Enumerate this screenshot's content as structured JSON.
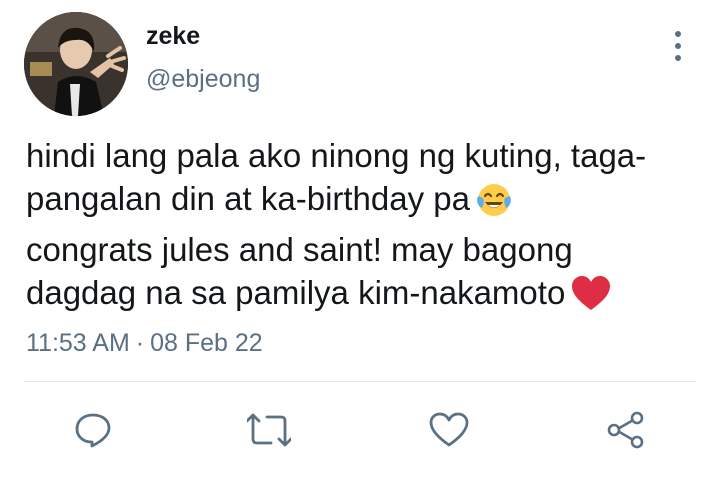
{
  "tweet": {
    "author": {
      "display_name": "zeke",
      "handle": "@ebjeong"
    },
    "text_lines": [
      "hindi lang pala ako ninong ng kuting, taga-",
      "pangalan din at ka-birthday pa",
      "congrats jules and saint! may bagong",
      "dagdag na sa pamilya kim-nakamoto"
    ],
    "emojis": [
      "face-with-tears-of-joy",
      "red-heart"
    ],
    "time": "11:53 AM",
    "separator": "·",
    "date": "08 Feb 22"
  },
  "actions": [
    "reply",
    "retweet",
    "like",
    "share"
  ],
  "colors": {
    "text": "#14171a",
    "secondary": "#5b7083",
    "divider": "#e1e8ed",
    "icon": "#5b7083",
    "heart": "#dd2e44",
    "emoji_face": "#ffcc4d"
  }
}
